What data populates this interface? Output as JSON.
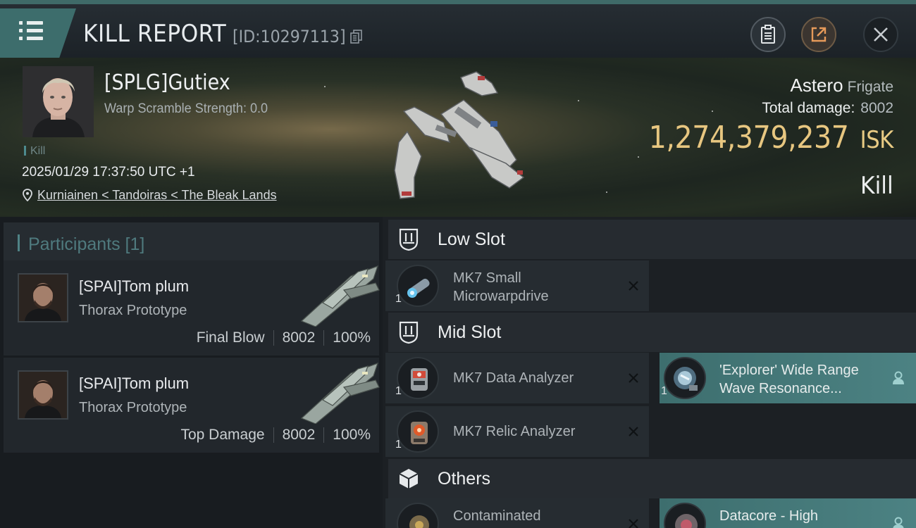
{
  "header": {
    "title": "KILL REPORT",
    "report_id": "[ID:10297113]"
  },
  "victim": {
    "name": "[SPLG]Gutiex",
    "warp_scramble": "Warp Scramble Strength: 0.0",
    "kill_tag": "Kill",
    "datetime": "2025/01/29 17:37:50 UTC +1",
    "location": "Kurniainen < Tandoiras < The Bleak Lands",
    "ship_name": "Astero",
    "ship_class": "Frigate",
    "total_damage_label": "Total damage:",
    "total_damage": "8002",
    "isk_value": "1,274,379,237",
    "isk_unit": "ISK",
    "result": "Kill"
  },
  "participants": {
    "heading": "Participants [1]",
    "items": [
      {
        "name": "[SPAI]Tom plum",
        "ship": "Thorax Prototype",
        "stat_label": "Final Blow",
        "damage": "8002",
        "percent": "100%"
      },
      {
        "name": "[SPAI]Tom plum",
        "ship": "Thorax Prototype",
        "stat_label": "Top Damage",
        "damage": "8002",
        "percent": "100%"
      }
    ]
  },
  "fitting": {
    "low_slot": {
      "title": "Low Slot",
      "modules": [
        {
          "name": "MK7 Small Microwarpdrive",
          "qty": "1"
        }
      ]
    },
    "mid_slot": {
      "title": "Mid Slot",
      "modules": [
        {
          "name": "MK7 Data Analyzer",
          "qty": "1"
        },
        {
          "name": "'Explorer' Wide Range Wave Resonance...",
          "qty": "1"
        },
        {
          "name": "MK7 Relic Analyzer",
          "qty": "1"
        }
      ]
    },
    "others": {
      "title": "Others",
      "modules": [
        {
          "name": "Contaminated"
        },
        {
          "name": "Datacore - High"
        }
      ]
    }
  },
  "colors": {
    "accent_teal": "#3d6d6c",
    "isk_gold": "#e7c680",
    "panel": "#262c31"
  }
}
